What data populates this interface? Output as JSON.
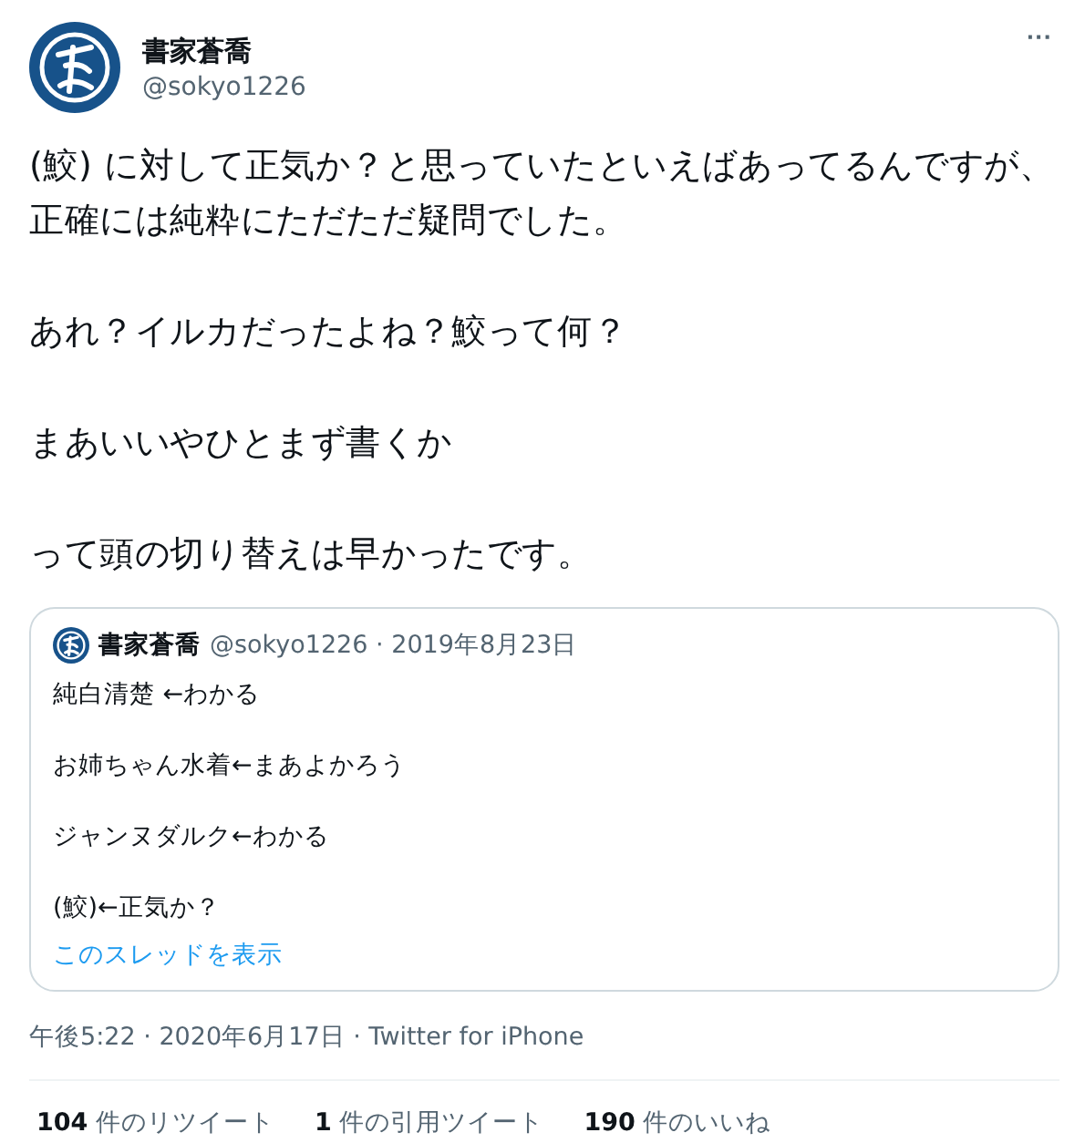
{
  "author": {
    "name": "書家蒼喬",
    "handle": "@sokyo1226"
  },
  "more": "···",
  "body": [
    "(鮫) に対して正気か？と思っていたといえばあってるんですが、正確には純粋にただただ疑問でした。",
    "あれ？イルカだったよね？鮫って何？",
    "まあいいやひとまず書くか",
    "って頭の切り替えは早かったです。"
  ],
  "quote": {
    "name": "書家蒼喬",
    "meta": "@sokyo1226 · 2019年8月23日",
    "lines": [
      "純白清楚 ←わかる",
      "お姉ちゃん水着←まあよかろう",
      "ジャンヌダルク←わかる",
      "(鮫)←正気か？"
    ],
    "link": "このスレッドを表示"
  },
  "timestamp": "午後5:22 · 2020年6月17日 · Twitter for iPhone",
  "stats": [
    {
      "count": "104",
      "label": "件のリツイート"
    },
    {
      "count": "1",
      "label": "件の引用ツイート"
    },
    {
      "count": "190",
      "label": "件のいいね"
    }
  ]
}
